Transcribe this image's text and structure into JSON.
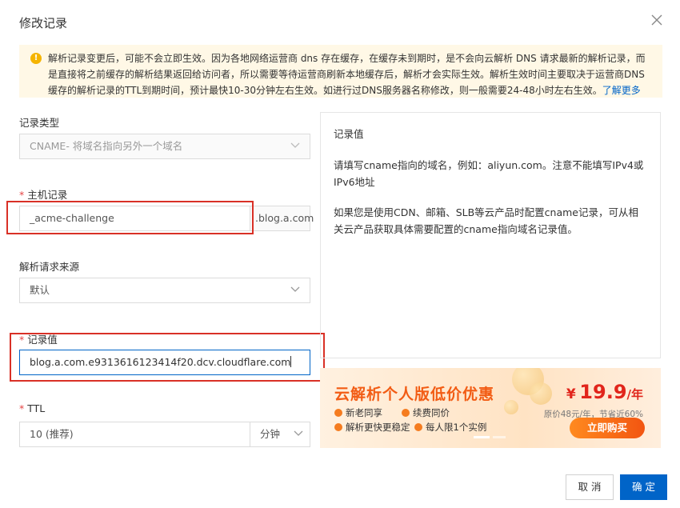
{
  "dialog": {
    "title": "修改记录"
  },
  "notice": {
    "text": "解析记录变更后，可能不会立即生效。因为各地网络运营商 dns 存在缓存，在缓存未到期时，是不会向云解析 DNS 请求最新的解析记录，而是直接将之前缓存的解析结果返回给访问者，所以需要等待运营商刷新本地缓存后，解析才会实际生效。解析生效时间主要取决于运营商DNS缓存的解析记录的TTL到期时间，预计最快10-30分钟左右生效。如进行过DNS服务器名称修改，则一般需要24-48小时左右生效。",
    "link": "了解更多"
  },
  "form": {
    "record_type": {
      "label": "记录类型",
      "value": "CNAME- 将域名指向另外一个域名"
    },
    "host": {
      "label": "主机记录",
      "value": "_acme-challenge",
      "suffix": ".blog.a.com"
    },
    "source": {
      "label": "解析请求来源",
      "value": "默认"
    },
    "record_value": {
      "label": "记录值",
      "value": "blog.a.com.e9313616123414f20.dcv.cloudflare.com"
    },
    "ttl": {
      "label": "TTL",
      "value": "10 (推荐)",
      "unit": "分钟"
    }
  },
  "help_panel": {
    "title": "记录值",
    "paragraphs": [
      "请填写cname指向的域名，例如：aliyun.com。注意不能填写IPv4或IPv6地址",
      "如果您是使用CDN、邮箱、SLB等云产品时配置cname记录，可从相关云产品获取具体需要配置的cname指向域名记录值。"
    ]
  },
  "banner": {
    "title": "云解析个人版低价优惠",
    "features": [
      "新老同享",
      "续费同价",
      "解析更快更稳定",
      "每人限1个实例"
    ],
    "price_currency": "¥",
    "price": "19.9",
    "price_unit": "/年",
    "original": "原价48元/年，节省近60%",
    "cta": "立即购买"
  },
  "footer": {
    "cancel": "取 消",
    "ok": "确 定"
  },
  "colors": {
    "primary": "#0064c8",
    "highlight": "#d93026",
    "required": "#e54545",
    "promo": "#f25c14"
  }
}
